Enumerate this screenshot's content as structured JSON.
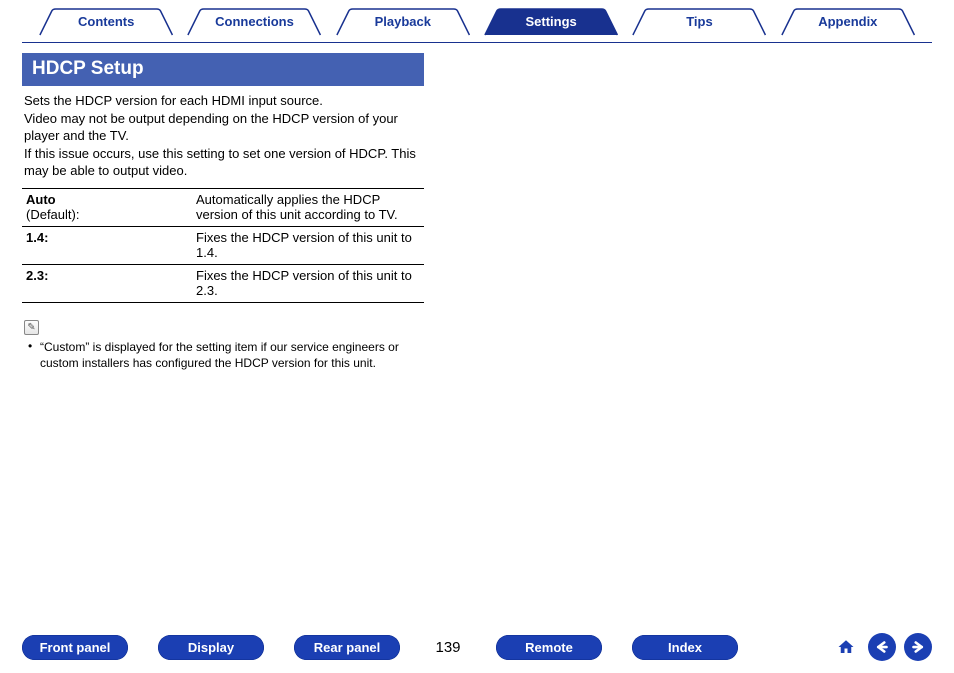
{
  "tabs": [
    {
      "label": "Contents",
      "active": false
    },
    {
      "label": "Connections",
      "active": false
    },
    {
      "label": "Playback",
      "active": false
    },
    {
      "label": "Settings",
      "active": true
    },
    {
      "label": "Tips",
      "active": false
    },
    {
      "label": "Appendix",
      "active": false
    }
  ],
  "section": {
    "title": "HDCP Setup",
    "intro": "Sets the HDCP version for each HDMI input source.\nVideo may not be output depending on the HDCP version of your player and the TV.\nIf this issue occurs, use this setting to set one version of HDCP. This may be able to output video."
  },
  "table": [
    {
      "key_main": "Auto",
      "key_sub": "(Default):",
      "desc": "Automatically applies the HDCP version of this unit according to TV."
    },
    {
      "key_main": "1.4:",
      "key_sub": "",
      "desc": "Fixes the HDCP version of this unit to 1.4."
    },
    {
      "key_main": "2.3:",
      "key_sub": "",
      "desc": "Fixes the HDCP version of this unit to 2.3."
    }
  ],
  "note_icon": "✎",
  "note": "“Custom” is displayed for the setting item if our service engineers or custom installers has configured the HDCP version for this unit.",
  "footer": {
    "buttons_left": [
      "Front panel",
      "Display",
      "Rear panel"
    ],
    "page": "139",
    "buttons_right": [
      "Remote",
      "Index"
    ]
  },
  "colors": {
    "brand": "#1b3fb3",
    "header": "#4461b2"
  }
}
